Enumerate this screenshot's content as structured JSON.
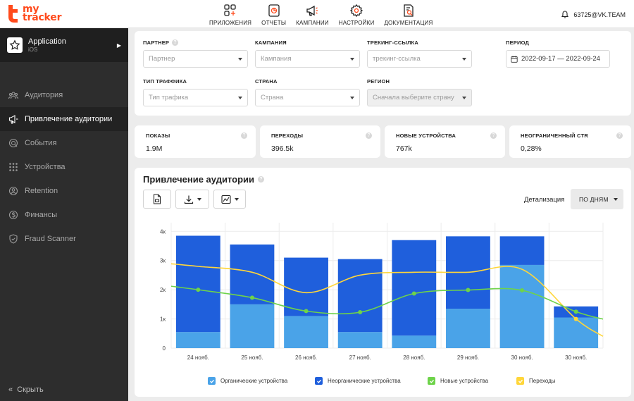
{
  "header": {
    "logo_line1": "my",
    "logo_line2": "tracker",
    "nav": [
      {
        "label": "ПРИЛОЖЕНИЯ",
        "icon": "apps-icon"
      },
      {
        "label": "ОТЧЕТЫ",
        "icon": "reports-icon"
      },
      {
        "label": "КАМПАНИИ",
        "icon": "megaphone-icon"
      },
      {
        "label": "НАСТРОЙКИ",
        "icon": "gear-icon"
      },
      {
        "label": "ДОКУМЕНТАЦИЯ",
        "icon": "docs-icon"
      }
    ],
    "user": "63725@VK.TEAM"
  },
  "sidebar": {
    "app_name": "Application",
    "app_platform": "iOS",
    "items": [
      {
        "label": "Аудитория",
        "icon": "audience-icon"
      },
      {
        "label": "Привлечение аудитории",
        "icon": "megaphone-icon"
      },
      {
        "label": "События",
        "icon": "events-icon"
      },
      {
        "label": "Устройства",
        "icon": "devices-icon"
      },
      {
        "label": "Retention",
        "icon": "retention-icon"
      },
      {
        "label": "Финансы",
        "icon": "finance-icon"
      },
      {
        "label": "Fraud Scanner",
        "icon": "shield-icon"
      }
    ],
    "active_index": 1,
    "collapse_label": "Скрыть"
  },
  "filters": {
    "partner": {
      "label": "ПАРТНЕР",
      "placeholder": "Партнер"
    },
    "campaign": {
      "label": "КАМПАНИЯ",
      "placeholder": "Кампания"
    },
    "tracking": {
      "label": "ТРЕКИНГ-ССЫЛКА",
      "placeholder": "трекинг-ссылка"
    },
    "period": {
      "label": "ПЕРИОД",
      "value": "2022-09-17 — 2022-09-24"
    },
    "traffic": {
      "label": "ТИП ТРАФФИКА",
      "placeholder": "Тип трафика"
    },
    "country": {
      "label": "СТРАНА",
      "placeholder": "Страна"
    },
    "region": {
      "label": "РЕГИОН",
      "placeholder": "Сначала выберите страну"
    }
  },
  "metrics": [
    {
      "title": "ПОКАЗЫ",
      "value": "1.9M"
    },
    {
      "title": "ПЕРЕХОДЫ",
      "value": "396.5k"
    },
    {
      "title": "НОВЫЕ УСТРОЙСТВА",
      "value": "767k"
    },
    {
      "title": "НЕОГРАНИЧЕННЫЙ CTR",
      "value": "0,28%"
    }
  ],
  "chart_section": {
    "title": "Привлечение аудитории",
    "detail_label": "Детализация",
    "detail_value": "ПО ДНЯМ"
  },
  "colors": {
    "organic": "#4aa3e8",
    "non_organic": "#1f5fdc",
    "new_devices": "#6ed34a",
    "clicks": "#ffd63a",
    "brand": "#ff4a1c"
  },
  "chart_data": {
    "type": "bar",
    "stacked": true,
    "categories": [
      "24 нояб.",
      "25 нояб.",
      "26 нояб.",
      "27 нояб.",
      "28 нояб.",
      "29 нояб.",
      "30 нояб.",
      "30 нояб."
    ],
    "yticks": [
      "0",
      "1к",
      "2к",
      "3к",
      "4к"
    ],
    "ylim": [
      0,
      4200
    ],
    "grid": true,
    "legend_position": "bottom",
    "series": [
      {
        "name": "Органические устройства",
        "kind": "bar",
        "values": [
          550,
          1500,
          1100,
          550,
          430,
          1350,
          2850,
          1050
        ]
      },
      {
        "name": "Неорганические устройства",
        "kind": "bar",
        "values": [
          3300,
          2050,
          2000,
          2500,
          3270,
          2480,
          980,
          380
        ]
      },
      {
        "name": "Новые устройства",
        "kind": "line",
        "values": [
          2000,
          1730,
          1270,
          1230,
          1870,
          1990,
          1980,
          1250
        ]
      },
      {
        "name": "Переходы",
        "kind": "line",
        "values": [
          2800,
          2600,
          1900,
          2500,
          2600,
          2600,
          2700,
          1000
        ]
      }
    ]
  }
}
